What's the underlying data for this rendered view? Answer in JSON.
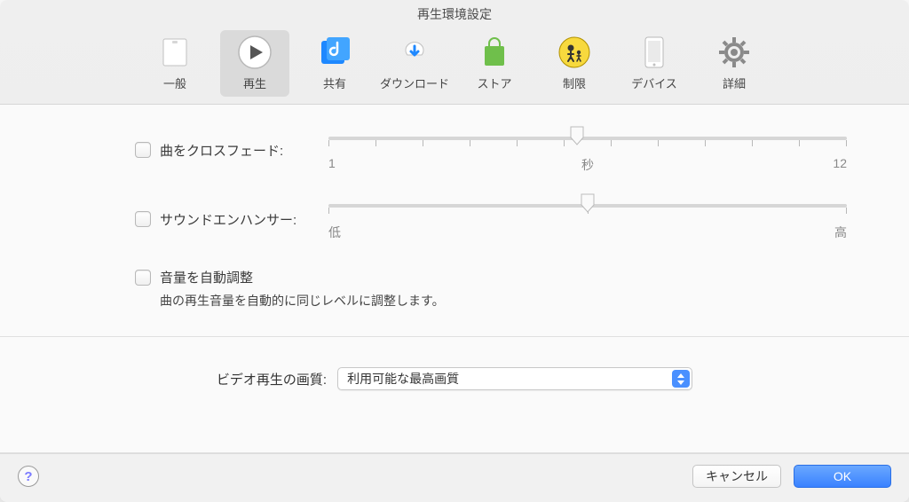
{
  "window": {
    "title": "再生環境設定"
  },
  "toolbar": {
    "items": [
      {
        "label": "一般"
      },
      {
        "label": "再生"
      },
      {
        "label": "共有"
      },
      {
        "label": "ダウンロード"
      },
      {
        "label": "ストア"
      },
      {
        "label": "制限"
      },
      {
        "label": "デバイス"
      },
      {
        "label": "詳細"
      }
    ],
    "active_index": 1
  },
  "crossfade": {
    "label": "曲をクロスフェード:",
    "checked": false,
    "min_label": "1",
    "mid_label": "秒",
    "max_label": "12",
    "value_percent": 48
  },
  "enhancer": {
    "label": "サウンドエンハンサー:",
    "checked": false,
    "min_label": "低",
    "max_label": "高",
    "value_percent": 50
  },
  "auto_volume": {
    "label": "音量を自動調整",
    "checked": false,
    "description": "曲の再生音量を自動的に同じレベルに調整します。"
  },
  "video_quality": {
    "label": "ビデオ再生の画質:",
    "selected": "利用可能な最高画質"
  },
  "footer": {
    "help": "?",
    "cancel": "キャンセル",
    "ok": "OK"
  }
}
